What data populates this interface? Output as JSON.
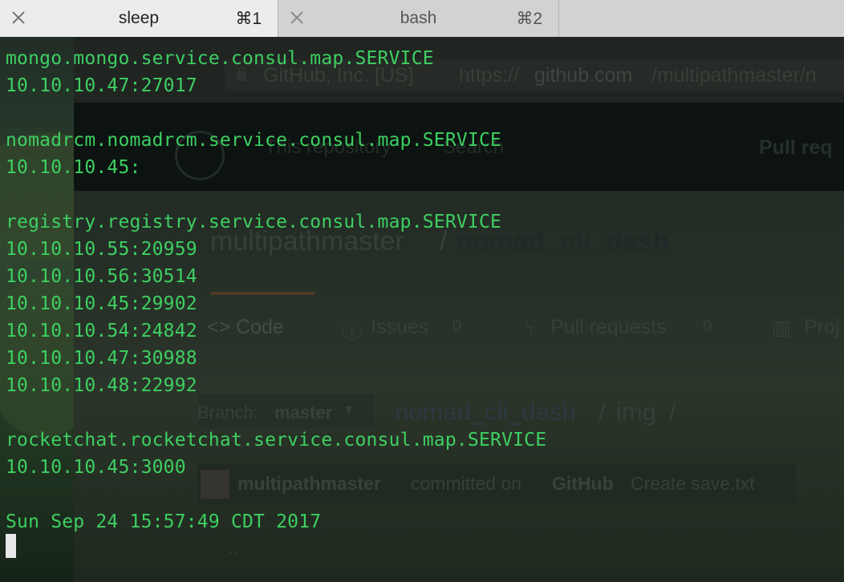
{
  "tabs": [
    {
      "title": "sleep",
      "shortcut": "⌘1",
      "active": true
    },
    {
      "title": "bash",
      "shortcut": "⌘2",
      "active": false
    }
  ],
  "terminal": {
    "lines": [
      "mongo.mongo.service.consul.map.SERVICE",
      "10.10.10.47:27017",
      "",
      "nomadrcm.nomadrcm.service.consul.map.SERVICE",
      "10.10.10.45:",
      "",
      "registry.registry.service.consul.map.SERVICE",
      "10.10.10.55:20959",
      "10.10.10.56:30514",
      "10.10.10.45:29902",
      "10.10.10.54:24842",
      "10.10.10.47:30988",
      "10.10.10.48:22992",
      "",
      "rocketchat.rocketchat.service.consul.map.SERVICE",
      "10.10.10.45:3000",
      "",
      "Sun Sep 24 15:57:49 CDT 2017"
    ]
  },
  "background_browser": {
    "cert_owner": "GitHub, Inc. [US]",
    "url_scheme": "https://",
    "url_host": "github.com",
    "url_path": "/multipathmaster/n",
    "search_scope": "This repository",
    "search_placeholder": "Search",
    "nav_pull_requests": "Pull req",
    "repo_owner": "multipathmaster",
    "repo_sep": "/",
    "repo_name": "nomad_cli_dash",
    "tab_code": "Code",
    "tab_issues": "Issues",
    "tab_issues_count": "0",
    "tab_pulls": "Pull requests",
    "tab_pulls_count": "0",
    "tab_projects": "Proj",
    "branch_prefix": "Branch:",
    "branch_name": "master",
    "path_repo": "nomad_cli_dash",
    "path_sep": "/",
    "path_dir": "img",
    "path_trail": "/",
    "commit_author": "multipathmaster",
    "commit_verb": "committed on",
    "commit_platform": "GitHub",
    "commit_message": "Create save.txt",
    "parent_dir": ".."
  },
  "colors": {
    "terminal_text": "#3ecf62",
    "cursor": "#e8e8e8"
  }
}
